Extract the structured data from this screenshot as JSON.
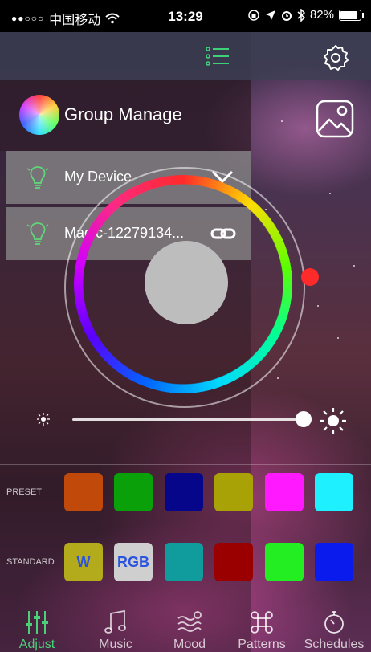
{
  "status_bar": {
    "signal_dots": "●●○○○",
    "carrier": "中国移动",
    "time": "13:29",
    "battery_percent": "82%",
    "battery_level": 0.82
  },
  "group": {
    "title": "Group Manage"
  },
  "devices": [
    {
      "name": "My Device",
      "action_icon": "chevron-down-icon"
    },
    {
      "name": "Magic-12279134...",
      "action_icon": "link-icon"
    }
  ],
  "color_wheel": {
    "handle_color": "#ff2a2a",
    "center_color": "#bdbdbd"
  },
  "brightness": {
    "level": 0.95
  },
  "preset": {
    "label": "PRESET",
    "colors": [
      "#c14a0a",
      "#09a00a",
      "#06068a",
      "#a8a206",
      "#ff19ff",
      "#1ff0ff"
    ]
  },
  "standard": {
    "label": "STANDARD",
    "swatches": [
      {
        "label": "W",
        "color": "#b3aa1c",
        "text_color": "#2a54e0"
      },
      {
        "label": "RGB",
        "color": "#cfcfcf",
        "text_color": "#2a54e0"
      },
      {
        "label": "",
        "color": "#109c9c"
      },
      {
        "label": "",
        "color": "#9a0000"
      },
      {
        "label": "",
        "color": "#22ee22"
      },
      {
        "label": "",
        "color": "#0a1bee"
      }
    ]
  },
  "tabs": [
    {
      "label": "Adjust",
      "icon": "equalizer-icon",
      "active": true
    },
    {
      "label": "Music",
      "icon": "music-note-icon",
      "active": false
    },
    {
      "label": "Mood",
      "icon": "mood-waves-icon",
      "active": false
    },
    {
      "label": "Patterns",
      "icon": "command-icon",
      "active": false
    },
    {
      "label": "Schedules",
      "icon": "stopwatch-icon",
      "active": false
    }
  ],
  "accent_color": "#4bd07a"
}
